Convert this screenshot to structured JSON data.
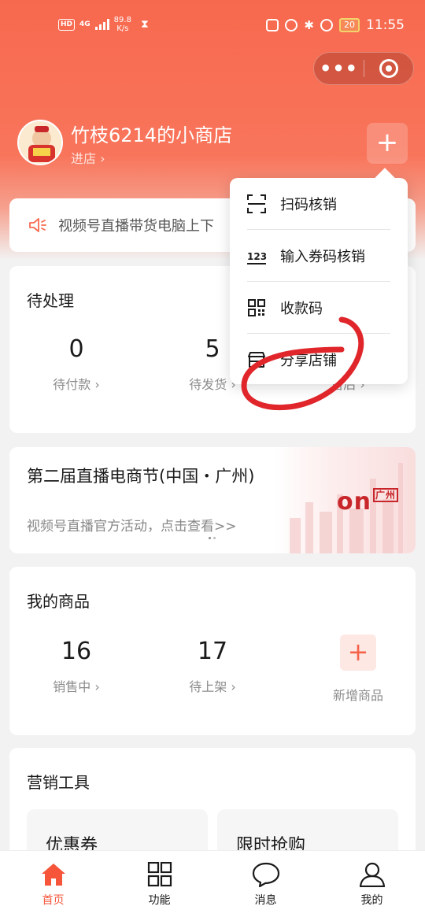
{
  "status_bar": {
    "hd_badge": "HD",
    "network": "4G",
    "net_speed_value": "89.8",
    "net_speed_unit": "K/s",
    "battery": "20",
    "time": "11:55"
  },
  "shop": {
    "name": "竹枝6214的小商店",
    "enter_link": "进店"
  },
  "notice": {
    "text": "视频号直播带货电脑上下"
  },
  "pending": {
    "title": "待处理",
    "items": [
      {
        "value": "0",
        "label": "待付款"
      },
      {
        "value": "5",
        "label": "待发货"
      },
      {
        "label": "售后"
      }
    ]
  },
  "banner": {
    "title": "第二届直播电商节(中国・广州)",
    "subtitle": "视频号直播官方活动，点击查看>>",
    "logo_text": "on",
    "logo_sub": "广州"
  },
  "my_products": {
    "title": "我的商品",
    "items": [
      {
        "value": "16",
        "label": "销售中"
      },
      {
        "value": "17",
        "label": "待上架"
      }
    ],
    "add_label": "新增商品"
  },
  "marketing": {
    "title": "营销工具",
    "tiles": [
      "优惠券",
      "限时抢购"
    ]
  },
  "dropdown": {
    "items": [
      {
        "label": "扫码核销",
        "icon": "scan-icon"
      },
      {
        "label": "输入券码核销",
        "icon": "number-123-icon",
        "icon_text": "123"
      },
      {
        "label": "收款码",
        "icon": "qrcode-icon"
      },
      {
        "label": "分享店铺",
        "icon": "share-shop-icon"
      }
    ]
  },
  "tabbar": {
    "tabs": [
      {
        "label": "首页",
        "icon": "home-icon",
        "active": true
      },
      {
        "label": "功能",
        "icon": "grid-icon"
      },
      {
        "label": "消息",
        "icon": "message-icon"
      },
      {
        "label": "我的",
        "icon": "user-icon"
      }
    ]
  },
  "colors": {
    "brand": "#f7694f",
    "accent": "#f6553a",
    "annotation": "#e0262b"
  }
}
